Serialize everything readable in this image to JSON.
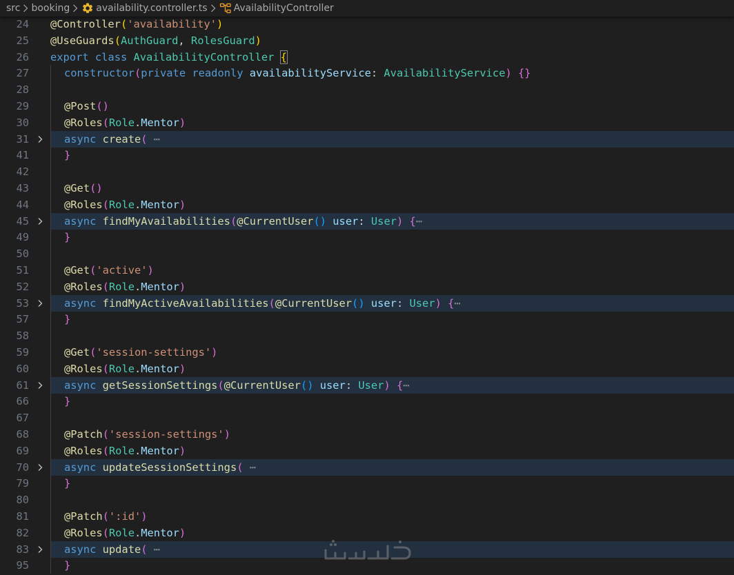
{
  "breadcrumb": {
    "items": [
      {
        "label": "src"
      },
      {
        "label": "booking"
      },
      {
        "label": "availability.controller.ts",
        "icon": "gear-icon",
        "icon_color": "#e8b52d"
      },
      {
        "label": "AvailabilityController",
        "icon": "class-icon",
        "icon_color": "#ee9d28"
      }
    ]
  },
  "colors": {
    "keyword": "#569cd6",
    "function": "#dcdcaa",
    "class": "#4ec9b0",
    "string": "#ce9178",
    "variable": "#9cdcfe",
    "default": "#d4d4d4",
    "bracket_1": "#ffd700",
    "bracket_2": "#da70d6",
    "bracket_3": "#179fff",
    "line_number": "#6e7681",
    "fold_highlight": "#22303f",
    "background": "#1f1f1f"
  },
  "editor": {
    "lines": [
      {
        "num": "24",
        "folded": false,
        "guide": false,
        "indent": 0,
        "tokens": [
          {
            "t": "@",
            "c": "fn"
          },
          {
            "t": "Controller",
            "c": "fn"
          },
          {
            "t": "(",
            "c": "b1"
          },
          {
            "t": "'availability'",
            "c": "str"
          },
          {
            "t": ")",
            "c": "b1"
          }
        ]
      },
      {
        "num": "25",
        "folded": false,
        "guide": false,
        "indent": 0,
        "tokens": [
          {
            "t": "@",
            "c": "fn"
          },
          {
            "t": "UseGuards",
            "c": "fn"
          },
          {
            "t": "(",
            "c": "b1"
          },
          {
            "t": "AuthGuard",
            "c": "cls"
          },
          {
            "t": ", ",
            "c": "def"
          },
          {
            "t": "RolesGuard",
            "c": "cls"
          },
          {
            "t": ")",
            "c": "b1"
          }
        ]
      },
      {
        "num": "26",
        "folded": false,
        "guide": false,
        "indent": 0,
        "tokens": [
          {
            "t": "export",
            "c": "kw"
          },
          {
            "t": " ",
            "c": "def"
          },
          {
            "t": "class",
            "c": "kw"
          },
          {
            "t": " ",
            "c": "def"
          },
          {
            "t": "AvailabilityController",
            "c": "cls"
          },
          {
            "t": " ",
            "c": "def"
          },
          {
            "t": "{",
            "c": "bo"
          }
        ]
      },
      {
        "num": "27",
        "folded": false,
        "guide": true,
        "indent": 1,
        "tokens": [
          {
            "t": "constructor",
            "c": "kw"
          },
          {
            "t": "(",
            "c": "b2"
          },
          {
            "t": "private",
            "c": "kw"
          },
          {
            "t": " ",
            "c": "def"
          },
          {
            "t": "readonly",
            "c": "kw"
          },
          {
            "t": " ",
            "c": "def"
          },
          {
            "t": "availabilityService",
            "c": "var"
          },
          {
            "t": ": ",
            "c": "def"
          },
          {
            "t": "AvailabilityService",
            "c": "cls"
          },
          {
            "t": ")",
            "c": "b2"
          },
          {
            "t": " ",
            "c": "def"
          },
          {
            "t": "{}",
            "c": "b2"
          }
        ]
      },
      {
        "num": "28",
        "folded": false,
        "guide": true,
        "indent": 1,
        "tokens": []
      },
      {
        "num": "29",
        "folded": false,
        "guide": true,
        "indent": 1,
        "tokens": [
          {
            "t": "@",
            "c": "fn"
          },
          {
            "t": "Post",
            "c": "fn"
          },
          {
            "t": "()",
            "c": "b2"
          }
        ]
      },
      {
        "num": "30",
        "folded": false,
        "guide": true,
        "indent": 1,
        "tokens": [
          {
            "t": "@",
            "c": "fn"
          },
          {
            "t": "Roles",
            "c": "fn"
          },
          {
            "t": "(",
            "c": "b2"
          },
          {
            "t": "Role",
            "c": "cls"
          },
          {
            "t": ".",
            "c": "def"
          },
          {
            "t": "Mentor",
            "c": "var"
          },
          {
            "t": ")",
            "c": "b2"
          }
        ]
      },
      {
        "num": "31",
        "folded": true,
        "guide": true,
        "indent": 1,
        "tokens": [
          {
            "t": "async",
            "c": "kw"
          },
          {
            "t": " ",
            "c": "def"
          },
          {
            "t": "create",
            "c": "fn"
          },
          {
            "t": "(",
            "c": "b2"
          }
        ],
        "ellipsis": " ⋯"
      },
      {
        "num": "41",
        "folded": false,
        "guide": true,
        "indent": 1,
        "tokens": [
          {
            "t": "}",
            "c": "b2"
          }
        ]
      },
      {
        "num": "42",
        "folded": false,
        "guide": true,
        "indent": 1,
        "tokens": []
      },
      {
        "num": "43",
        "folded": false,
        "guide": true,
        "indent": 1,
        "tokens": [
          {
            "t": "@",
            "c": "fn"
          },
          {
            "t": "Get",
            "c": "fn"
          },
          {
            "t": "()",
            "c": "b2"
          }
        ]
      },
      {
        "num": "44",
        "folded": false,
        "guide": true,
        "indent": 1,
        "tokens": [
          {
            "t": "@",
            "c": "fn"
          },
          {
            "t": "Roles",
            "c": "fn"
          },
          {
            "t": "(",
            "c": "b2"
          },
          {
            "t": "Role",
            "c": "cls"
          },
          {
            "t": ".",
            "c": "def"
          },
          {
            "t": "Mentor",
            "c": "var"
          },
          {
            "t": ")",
            "c": "b2"
          }
        ]
      },
      {
        "num": "45",
        "folded": true,
        "guide": true,
        "indent": 1,
        "tokens": [
          {
            "t": "async",
            "c": "kw"
          },
          {
            "t": " ",
            "c": "def"
          },
          {
            "t": "findMyAvailabilities",
            "c": "fn"
          },
          {
            "t": "(",
            "c": "b2"
          },
          {
            "t": "@",
            "c": "fn"
          },
          {
            "t": "CurrentUser",
            "c": "fn"
          },
          {
            "t": "()",
            "c": "b3"
          },
          {
            "t": " ",
            "c": "def"
          },
          {
            "t": "user",
            "c": "var"
          },
          {
            "t": ": ",
            "c": "def"
          },
          {
            "t": "User",
            "c": "cls"
          },
          {
            "t": ")",
            "c": "b2"
          },
          {
            "t": " ",
            "c": "def"
          },
          {
            "t": "{",
            "c": "b2"
          }
        ],
        "ellipsis": "⋯"
      },
      {
        "num": "49",
        "folded": false,
        "guide": true,
        "indent": 1,
        "tokens": [
          {
            "t": "}",
            "c": "b2"
          }
        ]
      },
      {
        "num": "50",
        "folded": false,
        "guide": true,
        "indent": 1,
        "tokens": []
      },
      {
        "num": "51",
        "folded": false,
        "guide": true,
        "indent": 1,
        "tokens": [
          {
            "t": "@",
            "c": "fn"
          },
          {
            "t": "Get",
            "c": "fn"
          },
          {
            "t": "(",
            "c": "b2"
          },
          {
            "t": "'active'",
            "c": "str"
          },
          {
            "t": ")",
            "c": "b2"
          }
        ]
      },
      {
        "num": "52",
        "folded": false,
        "guide": true,
        "indent": 1,
        "tokens": [
          {
            "t": "@",
            "c": "fn"
          },
          {
            "t": "Roles",
            "c": "fn"
          },
          {
            "t": "(",
            "c": "b2"
          },
          {
            "t": "Role",
            "c": "cls"
          },
          {
            "t": ".",
            "c": "def"
          },
          {
            "t": "Mentor",
            "c": "var"
          },
          {
            "t": ")",
            "c": "b2"
          }
        ]
      },
      {
        "num": "53",
        "folded": true,
        "guide": true,
        "indent": 1,
        "tokens": [
          {
            "t": "async",
            "c": "kw"
          },
          {
            "t": " ",
            "c": "def"
          },
          {
            "t": "findMyActiveAvailabilities",
            "c": "fn"
          },
          {
            "t": "(",
            "c": "b2"
          },
          {
            "t": "@",
            "c": "fn"
          },
          {
            "t": "CurrentUser",
            "c": "fn"
          },
          {
            "t": "()",
            "c": "b3"
          },
          {
            "t": " ",
            "c": "def"
          },
          {
            "t": "user",
            "c": "var"
          },
          {
            "t": ": ",
            "c": "def"
          },
          {
            "t": "User",
            "c": "cls"
          },
          {
            "t": ")",
            "c": "b2"
          },
          {
            "t": " ",
            "c": "def"
          },
          {
            "t": "{",
            "c": "b2"
          }
        ],
        "ellipsis": "⋯"
      },
      {
        "num": "57",
        "folded": false,
        "guide": true,
        "indent": 1,
        "tokens": [
          {
            "t": "}",
            "c": "b2"
          }
        ]
      },
      {
        "num": "58",
        "folded": false,
        "guide": true,
        "indent": 1,
        "tokens": []
      },
      {
        "num": "59",
        "folded": false,
        "guide": true,
        "indent": 1,
        "tokens": [
          {
            "t": "@",
            "c": "fn"
          },
          {
            "t": "Get",
            "c": "fn"
          },
          {
            "t": "(",
            "c": "b2"
          },
          {
            "t": "'session-settings'",
            "c": "str"
          },
          {
            "t": ")",
            "c": "b2"
          }
        ]
      },
      {
        "num": "60",
        "folded": false,
        "guide": true,
        "indent": 1,
        "tokens": [
          {
            "t": "@",
            "c": "fn"
          },
          {
            "t": "Roles",
            "c": "fn"
          },
          {
            "t": "(",
            "c": "b2"
          },
          {
            "t": "Role",
            "c": "cls"
          },
          {
            "t": ".",
            "c": "def"
          },
          {
            "t": "Mentor",
            "c": "var"
          },
          {
            "t": ")",
            "c": "b2"
          }
        ]
      },
      {
        "num": "61",
        "folded": true,
        "guide": true,
        "indent": 1,
        "tokens": [
          {
            "t": "async",
            "c": "kw"
          },
          {
            "t": " ",
            "c": "def"
          },
          {
            "t": "getSessionSettings",
            "c": "fn"
          },
          {
            "t": "(",
            "c": "b2"
          },
          {
            "t": "@",
            "c": "fn"
          },
          {
            "t": "CurrentUser",
            "c": "fn"
          },
          {
            "t": "()",
            "c": "b3"
          },
          {
            "t": " ",
            "c": "def"
          },
          {
            "t": "user",
            "c": "var"
          },
          {
            "t": ": ",
            "c": "def"
          },
          {
            "t": "User",
            "c": "cls"
          },
          {
            "t": ")",
            "c": "b2"
          },
          {
            "t": " ",
            "c": "def"
          },
          {
            "t": "{",
            "c": "b2"
          }
        ],
        "ellipsis": "⋯"
      },
      {
        "num": "66",
        "folded": false,
        "guide": true,
        "indent": 1,
        "tokens": [
          {
            "t": "}",
            "c": "b2"
          }
        ]
      },
      {
        "num": "67",
        "folded": false,
        "guide": true,
        "indent": 1,
        "tokens": []
      },
      {
        "num": "68",
        "folded": false,
        "guide": true,
        "indent": 1,
        "tokens": [
          {
            "t": "@",
            "c": "fn"
          },
          {
            "t": "Patch",
            "c": "fn"
          },
          {
            "t": "(",
            "c": "b2"
          },
          {
            "t": "'session-settings'",
            "c": "str"
          },
          {
            "t": ")",
            "c": "b2"
          }
        ]
      },
      {
        "num": "69",
        "folded": false,
        "guide": true,
        "indent": 1,
        "tokens": [
          {
            "t": "@",
            "c": "fn"
          },
          {
            "t": "Roles",
            "c": "fn"
          },
          {
            "t": "(",
            "c": "b2"
          },
          {
            "t": "Role",
            "c": "cls"
          },
          {
            "t": ".",
            "c": "def"
          },
          {
            "t": "Mentor",
            "c": "var"
          },
          {
            "t": ")",
            "c": "b2"
          }
        ]
      },
      {
        "num": "70",
        "folded": true,
        "guide": true,
        "indent": 1,
        "tokens": [
          {
            "t": "async",
            "c": "kw"
          },
          {
            "t": " ",
            "c": "def"
          },
          {
            "t": "updateSessionSettings",
            "c": "fn"
          },
          {
            "t": "(",
            "c": "b2"
          }
        ],
        "ellipsis": " ⋯"
      },
      {
        "num": "79",
        "folded": false,
        "guide": true,
        "indent": 1,
        "tokens": [
          {
            "t": "}",
            "c": "b2"
          }
        ]
      },
      {
        "num": "80",
        "folded": false,
        "guide": true,
        "indent": 1,
        "tokens": []
      },
      {
        "num": "81",
        "folded": false,
        "guide": true,
        "indent": 1,
        "tokens": [
          {
            "t": "@",
            "c": "fn"
          },
          {
            "t": "Patch",
            "c": "fn"
          },
          {
            "t": "(",
            "c": "b2"
          },
          {
            "t": "':id'",
            "c": "str"
          },
          {
            "t": ")",
            "c": "b2"
          }
        ]
      },
      {
        "num": "82",
        "folded": false,
        "guide": true,
        "indent": 1,
        "tokens": [
          {
            "t": "@",
            "c": "fn"
          },
          {
            "t": "Roles",
            "c": "fn"
          },
          {
            "t": "(",
            "c": "b2"
          },
          {
            "t": "Role",
            "c": "cls"
          },
          {
            "t": ".",
            "c": "def"
          },
          {
            "t": "Mentor",
            "c": "var"
          },
          {
            "t": ")",
            "c": "b2"
          }
        ]
      },
      {
        "num": "83",
        "folded": true,
        "guide": true,
        "indent": 1,
        "tokens": [
          {
            "t": "async",
            "c": "kw"
          },
          {
            "t": " ",
            "c": "def"
          },
          {
            "t": "update",
            "c": "fn"
          },
          {
            "t": "(",
            "c": "b2"
          }
        ],
        "ellipsis": " ⋯"
      },
      {
        "num": "95",
        "folded": false,
        "guide": true,
        "indent": 1,
        "tokens": [
          {
            "t": "}",
            "c": "b2"
          }
        ]
      }
    ]
  },
  "watermark": {
    "text": "خمسات"
  }
}
